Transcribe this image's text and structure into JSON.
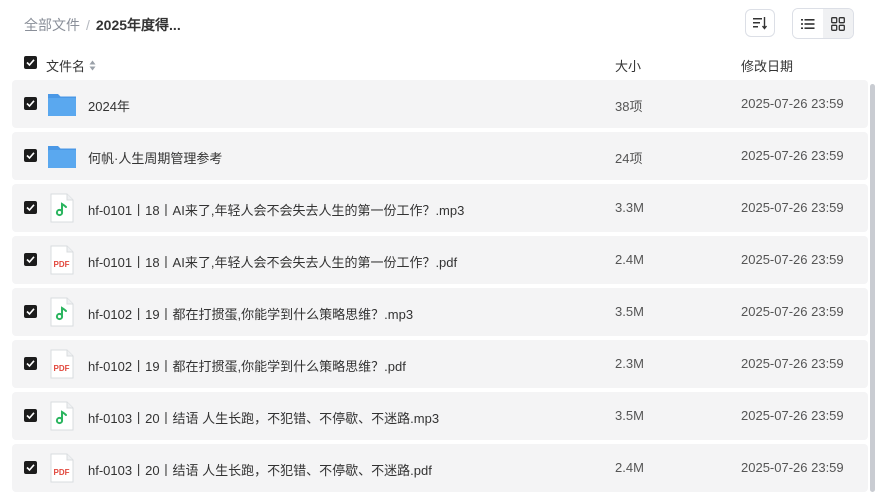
{
  "breadcrumb": {
    "root": "全部文件",
    "separator": "/",
    "current": "2025年度得..."
  },
  "header": {
    "name": "文件名",
    "size": "大小",
    "date": "修改日期"
  },
  "rows": [
    {
      "type": "folder",
      "name": "2024年",
      "size": "38项",
      "date": "2025-07-26 23:59"
    },
    {
      "type": "folder",
      "name": "何帆·人生周期管理参考",
      "size": "24项",
      "date": "2025-07-26 23:59"
    },
    {
      "type": "audio",
      "name": "hf-0101丨18丨AI来了,年轻人会不会失去人生的第一份工作？.mp3",
      "size": "3.3M",
      "date": "2025-07-26 23:59"
    },
    {
      "type": "pdf",
      "name": "hf-0101丨18丨AI来了,年轻人会不会失去人生的第一份工作？.pdf",
      "size": "2.4M",
      "date": "2025-07-26 23:59"
    },
    {
      "type": "audio",
      "name": "hf-0102丨19丨都在打掼蛋,你能学到什么策略思维？.mp3",
      "size": "3.5M",
      "date": "2025-07-26 23:59"
    },
    {
      "type": "pdf",
      "name": "hf-0102丨19丨都在打掼蛋,你能学到什么策略思维？.pdf",
      "size": "2.3M",
      "date": "2025-07-26 23:59"
    },
    {
      "type": "audio",
      "name": "hf-0103丨20丨结语 人生长跑，不犯错、不停歇、不迷路.mp3",
      "size": "3.5M",
      "date": "2025-07-26 23:59"
    },
    {
      "type": "pdf",
      "name": "hf-0103丨20丨结语 人生长跑，不犯错、不停歇、不迷路.pdf",
      "size": "2.4M",
      "date": "2025-07-26 23:59"
    }
  ],
  "icons": {
    "folder": "folder-icon",
    "audio": "music-note-icon",
    "pdf": "pdf-icon"
  },
  "colors": {
    "folder": "#5aa8ef",
    "audio_note": "#2bb55f",
    "pdf_text": "#e2483d"
  },
  "pdf_label": "PDF"
}
